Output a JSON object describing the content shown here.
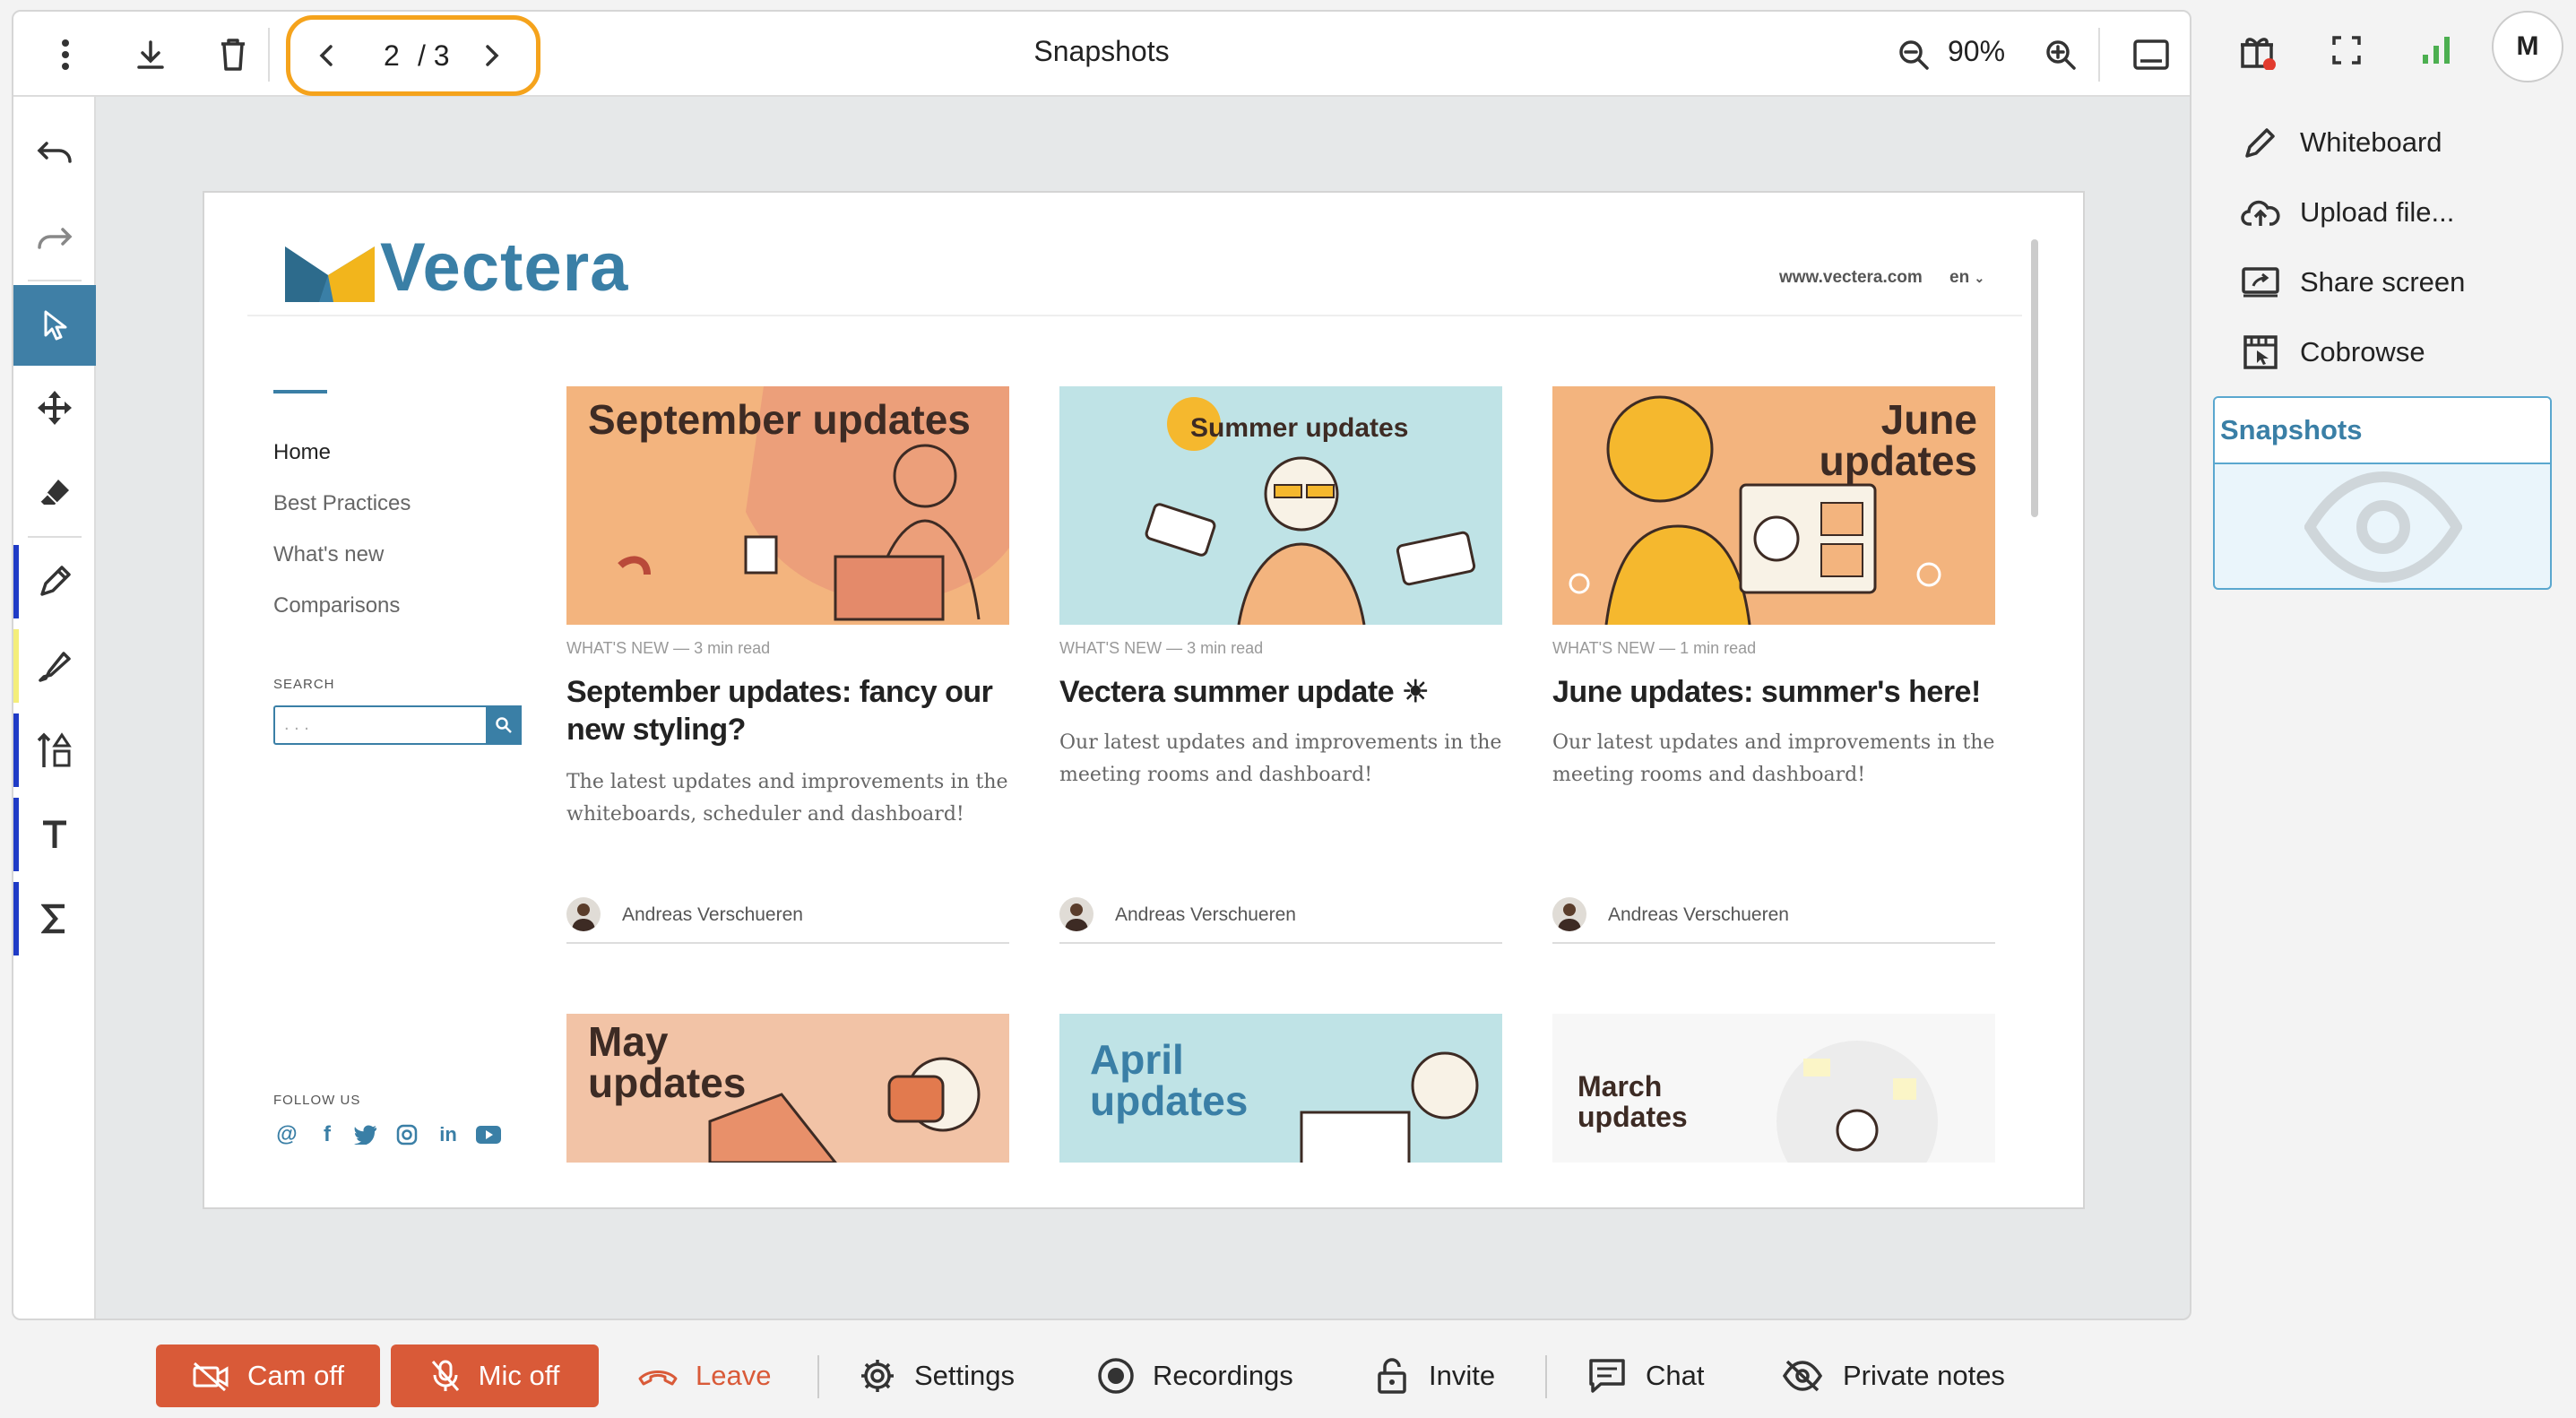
{
  "toolbar": {
    "title": "Snapshots",
    "page_current": "2",
    "page_total": "/ 3",
    "zoom": "90%"
  },
  "doc": {
    "logo": "Vectera",
    "site_url": "www.vectera.com",
    "lang": "en",
    "nav": [
      "Home",
      "Best Practices",
      "What's new",
      "Comparisons"
    ],
    "search_label": "SEARCH",
    "search_placeholder": ". . .",
    "follow_label": "FOLLOW US",
    "cards": [
      {
        "thumb_title": "September updates",
        "meta": "WHAT'S NEW  —  3 min read",
        "title": "September updates: fancy our new styling?",
        "excerpt": "The latest updates and improvements in the whiteboards, scheduler and dashboard!",
        "author": "Andreas Verschueren"
      },
      {
        "thumb_title": "Summer updates",
        "meta": "WHAT'S NEW  —  3 min read",
        "title": "Vectera summer update ☀",
        "excerpt": "Our latest updates and improvements in the meeting rooms and dashboard!",
        "author": "Andreas Verschueren"
      },
      {
        "thumb_title": "June updates",
        "meta": "WHAT'S NEW  —  1 min read",
        "title": "June updates: summer's here!",
        "excerpt": "Our latest updates and improvements in the meeting rooms and dashboard!",
        "author": "Andreas Verschueren"
      }
    ],
    "cards_row2": [
      {
        "thumb_title": "May updates"
      },
      {
        "thumb_title": "April updates"
      },
      {
        "thumb_title": "March updates"
      }
    ]
  },
  "right_panel": {
    "avatar_initial": "M",
    "menu": [
      {
        "label": "Whiteboard",
        "icon": "pencil-icon"
      },
      {
        "label": "Upload file...",
        "icon": "cloud-upload-icon"
      },
      {
        "label": "Share screen",
        "icon": "share-screen-icon"
      },
      {
        "label": "Cobrowse",
        "icon": "cobrowse-icon"
      }
    ],
    "snapshots_title": "Snapshots"
  },
  "bottom_bar": {
    "cam": "Cam off",
    "mic": "Mic off",
    "leave": "Leave",
    "settings": "Settings",
    "recordings": "Recordings",
    "invite": "Invite",
    "chat": "Chat",
    "private_notes": "Private notes"
  },
  "colors": {
    "accent": "#3a7fa6",
    "pager_highlight": "#f5a31c",
    "danger": "#d95a38",
    "leave_text": "#d95a38"
  }
}
